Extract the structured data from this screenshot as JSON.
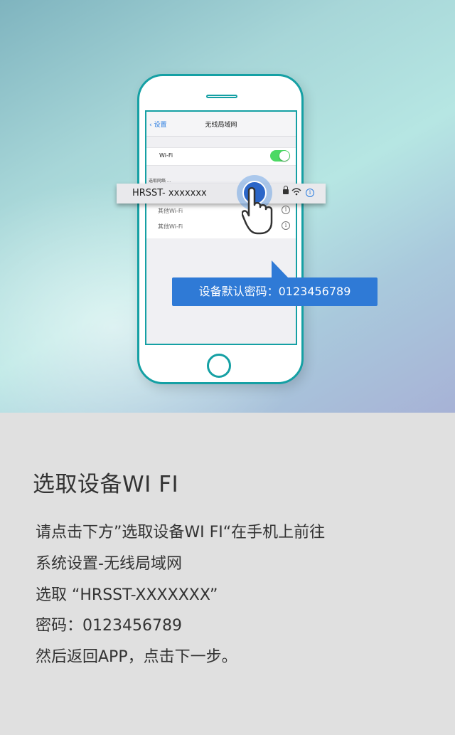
{
  "phone": {
    "nav_back": "设置",
    "nav_title": "无线局域网",
    "wifi_label": "Wi-Fi",
    "wifi_on": true,
    "networks_header": "选取网络 ...",
    "networks": [
      "其他Wi-Fi",
      "其他Wi-Fi"
    ],
    "highlighted_ssid": "HRSST- xxxxxxx"
  },
  "tooltip": "设备默认密码：0123456789",
  "colors": {
    "accent": "#2f7ad6",
    "phone_border": "#15a0a4",
    "toggle_on": "#4cd964"
  },
  "section": {
    "title": "选取设备WI FI",
    "lines": [
      "请点击下方”选取设备WI FI“在手机上前往",
      "系统设置-无线局域网",
      "选取 “HRSST-XXXXXXX”",
      "密码：0123456789",
      "然后返回APP，点击下一步。"
    ]
  }
}
